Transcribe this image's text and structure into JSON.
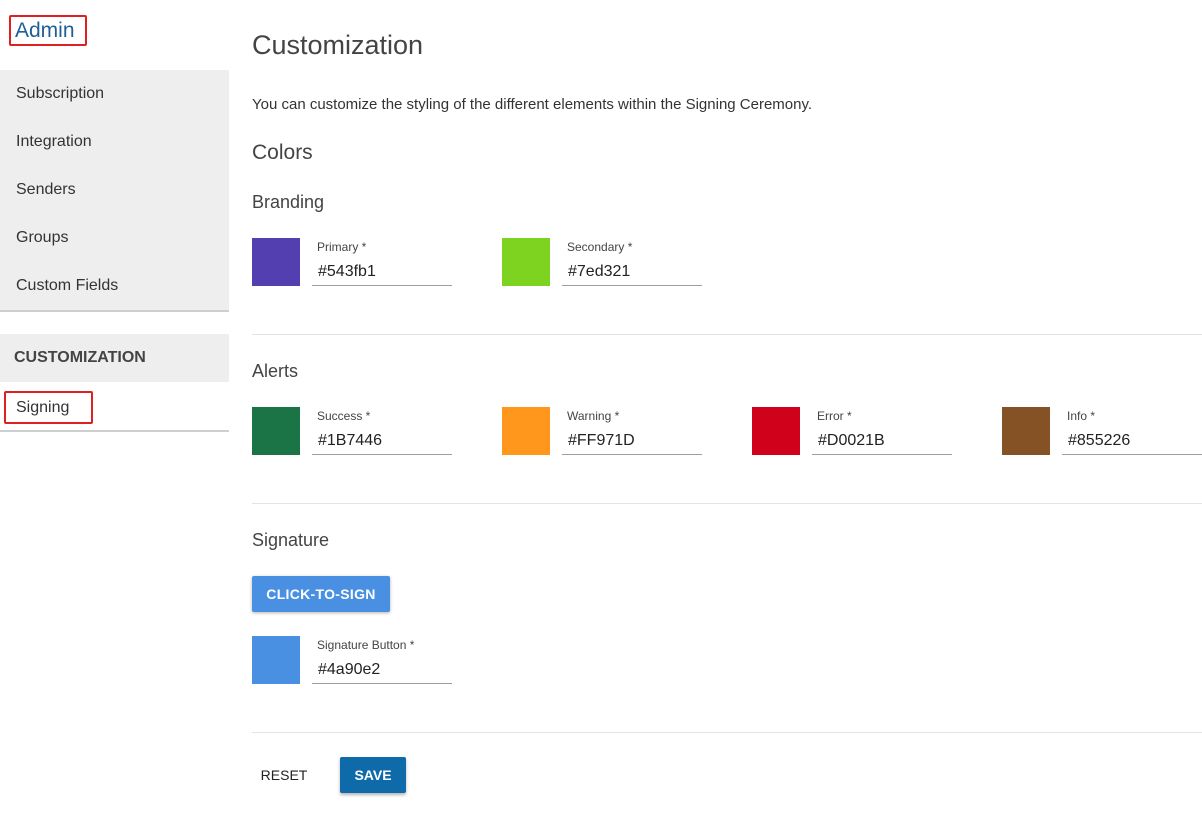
{
  "sidebar": {
    "title": "Admin",
    "items": [
      {
        "label": "Subscription"
      },
      {
        "label": "Integration"
      },
      {
        "label": "Senders"
      },
      {
        "label": "Groups"
      },
      {
        "label": "Custom Fields"
      }
    ],
    "section_heading": "CUSTOMIZATION",
    "active_item": "Signing"
  },
  "main": {
    "title": "Customization",
    "intro": "You can customize the styling of the different elements within the Signing Ceremony.",
    "colors_heading": "Colors",
    "branding": {
      "heading": "Branding",
      "fields": [
        {
          "label": "Primary *",
          "value": "#543fb1",
          "color": "#543fb1"
        },
        {
          "label": "Secondary *",
          "value": "#7ed321",
          "color": "#7ed321"
        }
      ]
    },
    "alerts": {
      "heading": "Alerts",
      "fields": [
        {
          "label": "Success *",
          "value": "#1B7446",
          "color": "#1B7446"
        },
        {
          "label": "Warning *",
          "value": "#FF971D",
          "color": "#FF971D"
        },
        {
          "label": "Error *",
          "value": "#D0021B",
          "color": "#D0021B"
        },
        {
          "label": "Info *",
          "value": "#855226",
          "color": "#855226"
        }
      ]
    },
    "signature": {
      "heading": "Signature",
      "button_label": "CLICK-TO-SIGN",
      "field": {
        "label": "Signature Button *",
        "value": "#4a90e2",
        "color": "#4a90e2"
      }
    },
    "actions": {
      "reset_label": "RESET",
      "save_label": "SAVE"
    }
  }
}
